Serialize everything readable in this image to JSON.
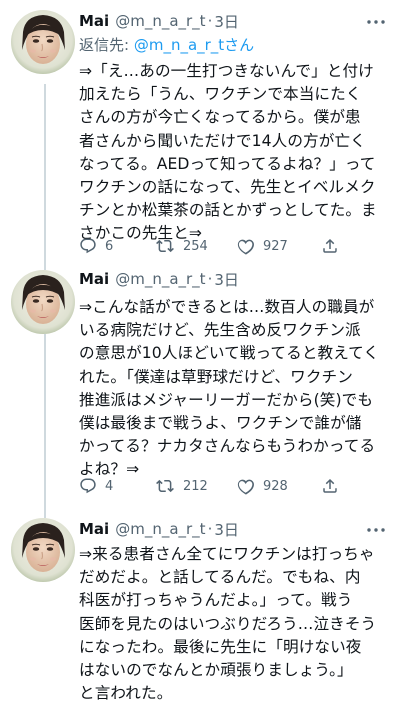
{
  "tweets": [
    {
      "name": "Mai",
      "handle": "@m_n_a_r_t",
      "dot": "·",
      "date": "3日",
      "reply_label": "返信先: ",
      "reply_target": "@m_n_a_r_tさん",
      "text": "⇒「え…あの一生打つきないんで」と付け\n加えたら「うん、ワクチンで本当にたく\nさんの方が今亡くなってるから。僕が患\n者さんから聞いただけで14人の方が亡く\nなってる。AEDって知ってるよね？」って\nワクチンの話になって、先生とイベルメク\nチンとか松葉茶の話とかずっとしてた。ま\nさかこの先生と⇒",
      "reply_count": "6",
      "retweet_count": "254",
      "like_count": "927"
    },
    {
      "name": "Mai",
      "handle": "@m_n_a_r_t",
      "dot": "·",
      "date": "3日",
      "text": "⇒こんな話ができるとは…数百人の職員が\nいる病院だけど、先生含め反ワクチン派\nの意思が10人ほどいて戦ってると教えてく\nれた。「僕達は草野球だけど、ワクチン\n推進派はメジャーリーガーだから(笑)でも\n僕は最後まで戦うよ、ワクチンで誰が儲\nかってる？ナカタさんならもうわかってる\nよね？⇒",
      "reply_count": "4",
      "retweet_count": "212",
      "like_count": "928"
    },
    {
      "name": "Mai",
      "handle": "@m_n_a_r_t",
      "dot": "·",
      "date": "3日",
      "text": "⇒来る患者さん全てにワクチンは打っちゃ\nだめだよ。と話してるんだ。でもね、内\n科医が打っちゃうんだよ。」って。戦う\n医師を見たのはいつぶりだろう…泣きそう\nになったわ。最後に先生に「明けない夜\nはないのでなんとか頑張りましょう。」\nと言われた。"
    }
  ],
  "icons": {
    "more": "more-horizontal-icon",
    "reply": "reply-bubble-icon",
    "retweet": "retweet-icon",
    "like": "heart-icon",
    "share": "share-icon"
  },
  "colors": {
    "text": "#0f1419",
    "secondary": "#536471",
    "link": "#1d9bf0",
    "thread_line": "#cfd9de"
  }
}
